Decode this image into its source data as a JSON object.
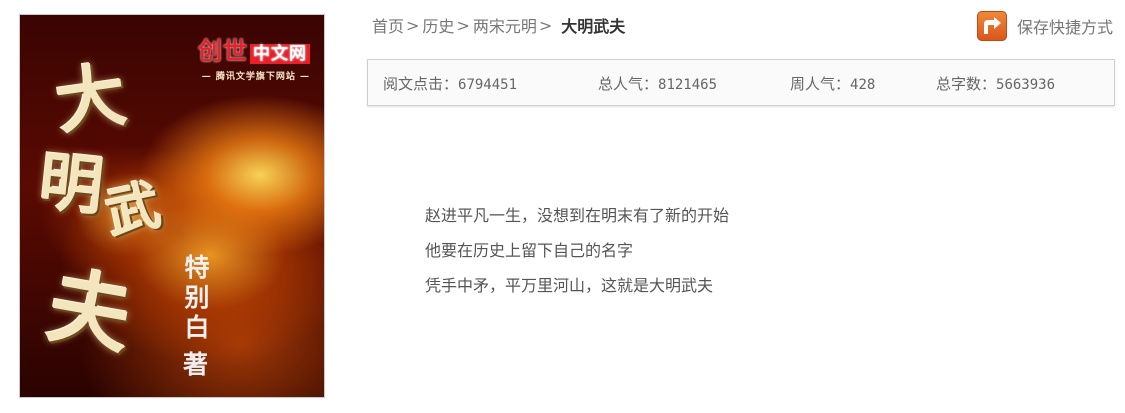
{
  "cover": {
    "logo_main": "创世",
    "logo_cn": "中文网",
    "logo_tagline": "— 腾讯文学旗下网站 —",
    "title_chars": [
      "大",
      "明",
      "武",
      "夫"
    ],
    "author_chars": [
      "特",
      "别",
      "白"
    ],
    "author_suffix": "著"
  },
  "breadcrumb": {
    "items": [
      {
        "label": "首页"
      },
      {
        "label": "历史"
      },
      {
        "label": "两宋元明"
      }
    ],
    "separator": ">",
    "current": "大明武夫"
  },
  "shortcut": {
    "label": "保存快捷方式",
    "icon": "shortcut-icon",
    "icon_color": "#e46a26"
  },
  "stats": {
    "reads": {
      "label": "阅文点击：",
      "value": "6794451"
    },
    "total_popularity": {
      "label": "总人气：",
      "value": "8121465"
    },
    "weekly_popularity": {
      "label": "周人气：",
      "value": "428"
    },
    "word_count": {
      "label": "总字数：",
      "value": "5663936"
    }
  },
  "description": {
    "lines": [
      "赵进平凡一生，没想到在明末有了新的开始",
      "他要在历史上留下自己的名字",
      "凭手中矛，平万里河山，这就是大明武夫"
    ]
  }
}
